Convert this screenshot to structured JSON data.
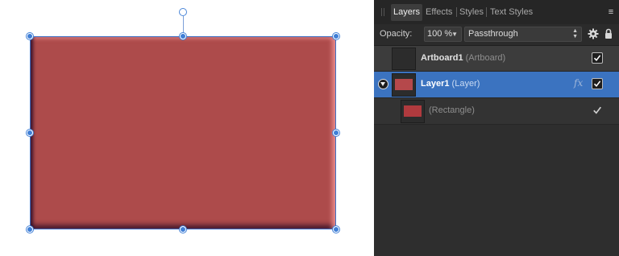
{
  "canvas": {
    "shape_fill": "#ad4b4b",
    "selection_color": "#3f7fd6"
  },
  "panel": {
    "tabs": [
      {
        "label": "Layers",
        "active": true
      },
      {
        "label": "Effects",
        "active": false
      },
      {
        "label": "Styles",
        "active": false
      },
      {
        "label": "Text Styles",
        "active": false
      }
    ],
    "menu_icon": "panel-menu-icon",
    "opacity_label": "Opacity:",
    "opacity_value": "100 %",
    "blend_mode": "Passthrough",
    "settings_icon": "gear-icon",
    "lock_icon": "lock-icon"
  },
  "layers": [
    {
      "name": "Artboard1",
      "type": "(Artboard)",
      "visible": true,
      "selected": false
    },
    {
      "name": "Layer1",
      "type": "(Layer)",
      "visible": true,
      "selected": true,
      "has_fx": true,
      "fx_label": "fx",
      "expanded": true
    },
    {
      "name": "",
      "type": "(Rectangle)",
      "visible": true,
      "selected": false
    }
  ],
  "colors": {
    "selected_row": "#3b73c0",
    "panel_bg": "#2e2e2e"
  }
}
